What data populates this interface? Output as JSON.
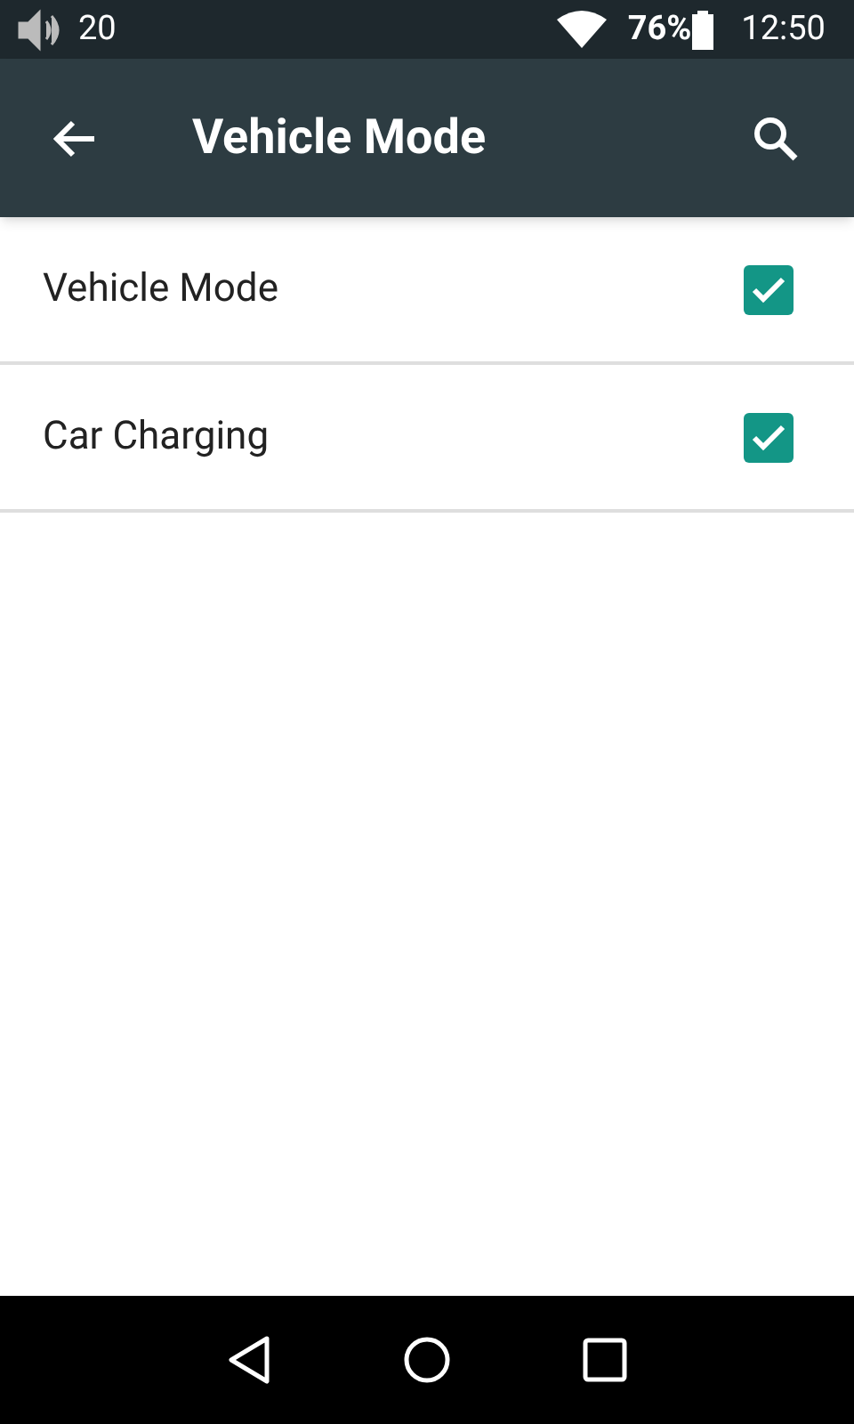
{
  "status_bar": {
    "volume": "20",
    "battery": "76%",
    "time": "12:50"
  },
  "toolbar": {
    "title": "Vehicle Mode"
  },
  "items": [
    {
      "label": "Vehicle Mode",
      "checked": true
    },
    {
      "label": "Car Charging",
      "checked": true
    }
  ]
}
